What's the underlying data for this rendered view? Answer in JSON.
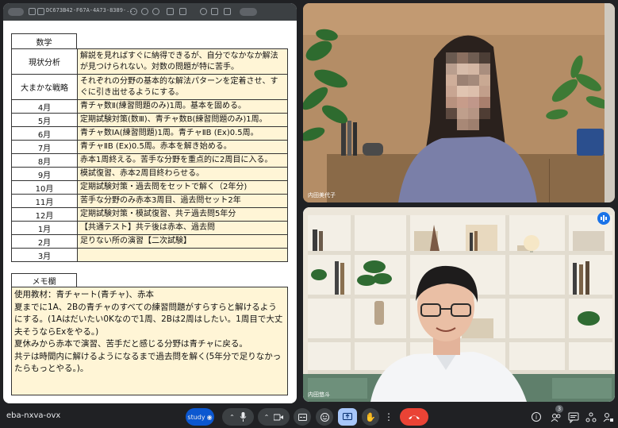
{
  "toolbar": {
    "doc_id": "DC673B42-F67A-4A73-8389-..."
  },
  "subject": "数学",
  "sections": [
    {
      "label": "現状分析",
      "text": "解説を見ればすぐに納得できるが、自分でなかなか解法が見つけられない。対数の問題が特に苦手。"
    },
    {
      "label": "大まかな戦略",
      "text": "それぞれの分野の基本的な解法パターンを定着させ、すぐに引き出せるようにする。"
    }
  ],
  "months": [
    {
      "month": "4月",
      "plan": "青チャ数Ⅱ(練習問題のみ)1周。基本を固める。"
    },
    {
      "month": "5月",
      "plan": "定期試験対策(数Ⅲ)、青チャ数B(練習問題のみ)1周。"
    },
    {
      "month": "6月",
      "plan": "青チャ数ⅠA(練習問題)1周。青チャⅡB (Ex)0.5周。"
    },
    {
      "month": "7月",
      "plan": "青チャⅡB (Ex)0.5周。赤本を解き始める。"
    },
    {
      "month": "8月",
      "plan": "赤本1周終える。苦手な分野を重点的に2周目に入る。"
    },
    {
      "month": "9月",
      "plan": "模試復習、赤本2周目終わらせる。"
    },
    {
      "month": "10月",
      "plan": "定期試験対策・過去問をセットで解く（2年分)"
    },
    {
      "month": "11月",
      "plan": "苦手な分野のみ赤本3周目、過去問セット2年"
    },
    {
      "month": "12月",
      "plan": "定期試験対策・模試復習、共テ過去問5年分"
    },
    {
      "month": "1月",
      "plan": "【共通テスト】共テ後は赤本、過去問"
    },
    {
      "month": "2月",
      "plan": "足りない所の演習【二次試験】"
    },
    {
      "month": "3月",
      "plan": ""
    }
  ],
  "memo": {
    "label": "メモ欄",
    "lines": [
      "使用教材：青チャート(青チャ)、赤本",
      "夏までに1A、2Bの青チャのすべての練習問題がすらすらと解けるようにする。(1Aはだいたい0Kなので1周、2Bは2周はしたい。1周目で大丈夫そうならExをやる。)",
      "夏休みから赤本で演習、苦手だと感じる分野は青チャに戻る。",
      "共テは時間内に解けるようになるまで過去問を解く(5年分で足りなかったらもっとやる。)。"
    ]
  },
  "participants": [
    {
      "name": "内田美代子"
    },
    {
      "name": "内田悠斗"
    }
  ],
  "meeting": {
    "code": "eba-nxva-ovx",
    "app_badge": "study",
    "participants_count": "3"
  },
  "colors": {
    "accent": "#8ab4f8",
    "end_call": "#ea4335",
    "table_fill": "#fff5d6",
    "present": "#0b57d0"
  }
}
